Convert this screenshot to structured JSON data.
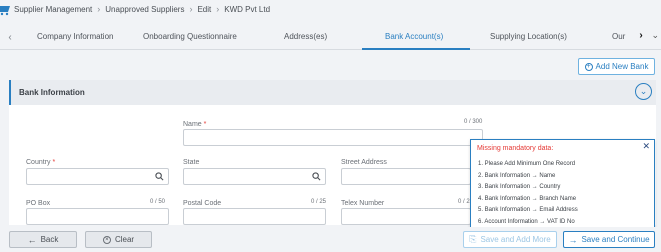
{
  "breadcrumb": [
    "Supplier Management",
    "Unapproved Suppliers",
    "Edit",
    "KWD Pvt Ltd"
  ],
  "tabs": [
    {
      "label": "Company Information",
      "active": false
    },
    {
      "label": "Onboarding Questionnaire",
      "active": false
    },
    {
      "label": "Address(es)",
      "active": false
    },
    {
      "label": "Bank Account(s)",
      "active": true
    },
    {
      "label": "Supplying Location(s)",
      "active": false
    },
    {
      "label": "Our",
      "active": false
    }
  ],
  "add_new_bank": "Add New Bank",
  "section": {
    "title": "Bank Information"
  },
  "fields": {
    "name": {
      "label": "Name",
      "required": true,
      "counter": "0 / 300",
      "value": ""
    },
    "country": {
      "label": "Country",
      "required": true,
      "value": ""
    },
    "state": {
      "label": "State",
      "required": false,
      "value": ""
    },
    "street_address": {
      "label": "Street Address",
      "counter": "0 / 300",
      "value": ""
    },
    "po_box": {
      "label": "PO Box",
      "counter": "0 / 50",
      "value": ""
    },
    "postal_code": {
      "label": "Postal Code",
      "counter": "0 / 25",
      "value": ""
    },
    "telex_number": {
      "label": "Telex Number",
      "counter": "0 / 25",
      "value": ""
    }
  },
  "required_marker": "*",
  "popup": {
    "title": "Missing mandatory data:",
    "items": [
      "1. Please Add Minimum One Record",
      "2. Bank Information → Name",
      "3. Bank Information → Country",
      "4. Bank Information → Branch Name",
      "5. Bank Information → Email Address",
      "6. Account Information → VAT ID No"
    ]
  },
  "footer": {
    "back": "Back",
    "clear": "Clear",
    "save_add_more": "Save and Add More",
    "save_continue": "Save and Continue"
  },
  "colors": {
    "accent": "#2a7fc1",
    "required": "#e53935",
    "error_title": "#e53935"
  }
}
